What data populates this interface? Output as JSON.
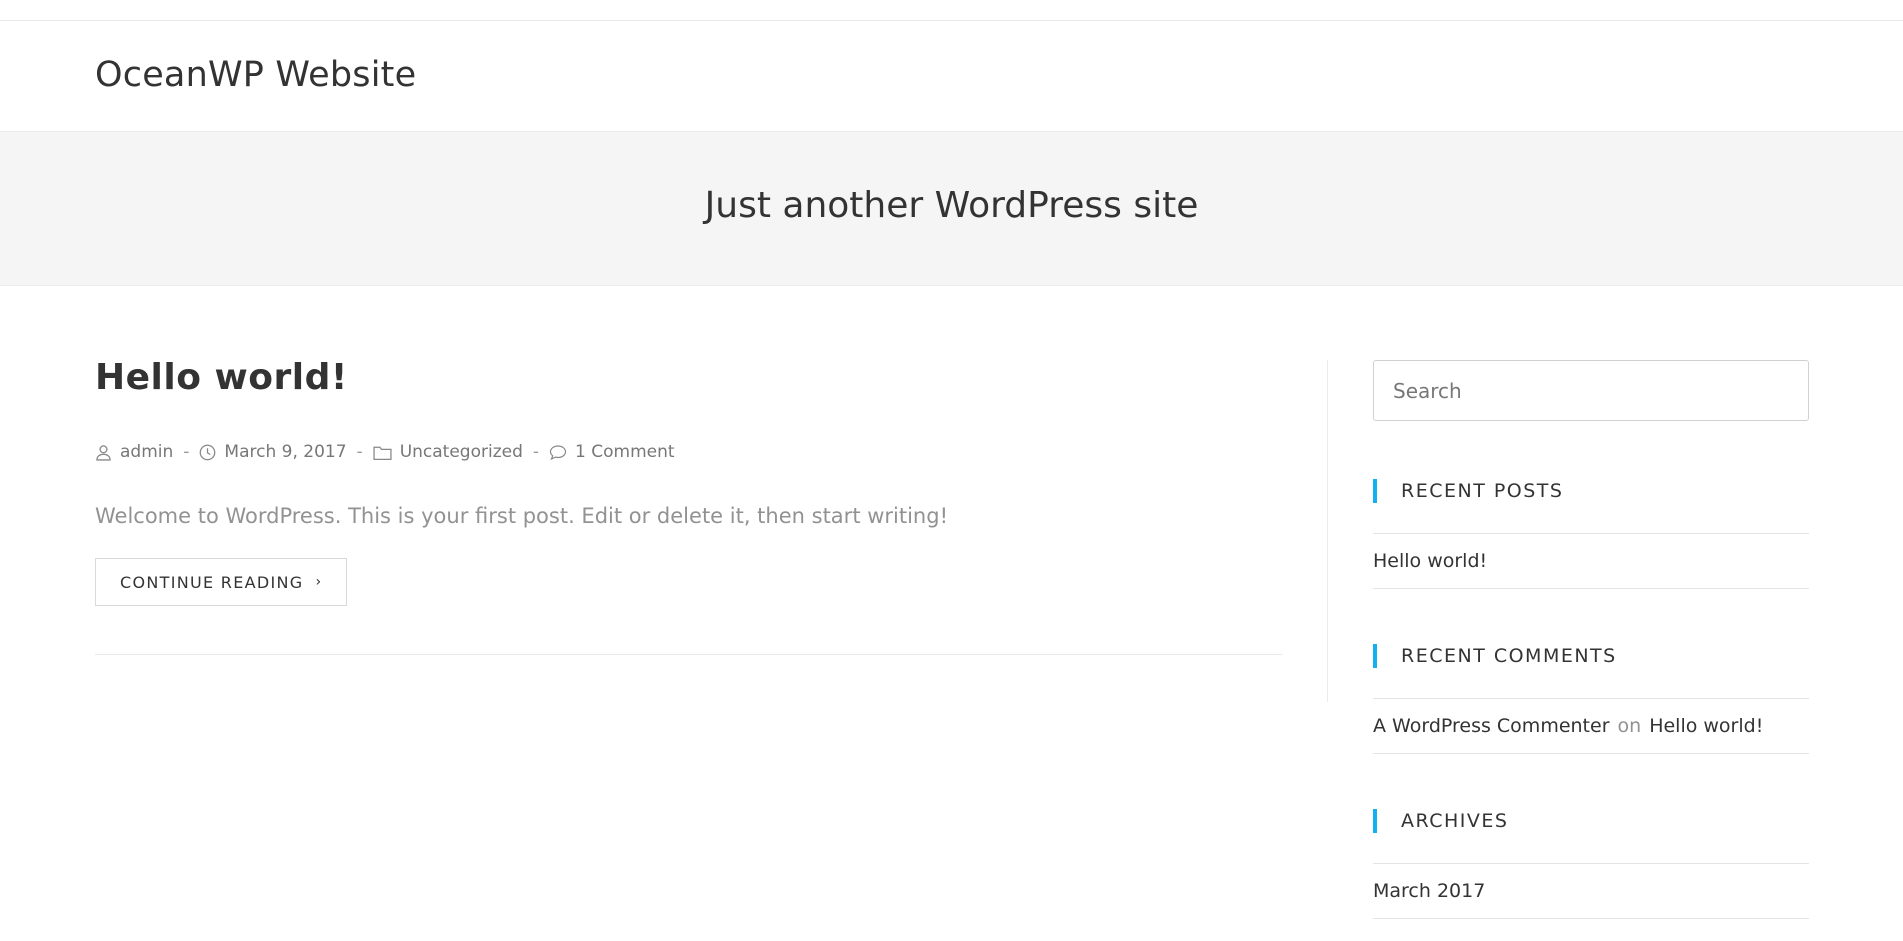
{
  "site": {
    "title": "OceanWP Website",
    "tagline": "Just another WordPress site"
  },
  "post": {
    "title": "Hello world!",
    "author": "admin",
    "date": "March 9, 2017",
    "category": "Uncategorized",
    "comments": "1 Comment",
    "separator": "-",
    "excerpt": "Welcome to WordPress. This is your first post. Edit or delete it, then start writing!",
    "continue_label": "CONTINUE READING",
    "continue_icon": "chevron-right-icon"
  },
  "sidebar": {
    "search": {
      "placeholder": "Search",
      "value": ""
    },
    "recent_posts": {
      "title": "RECENT POSTS",
      "items": [
        "Hello world!"
      ]
    },
    "recent_comments": {
      "title": "RECENT COMMENTS",
      "author": "A WordPress Commenter",
      "on": "on",
      "post": "Hello world!"
    },
    "archives": {
      "title": "ARCHIVES",
      "items": [
        "March 2017"
      ]
    }
  },
  "colors": {
    "accent": "#13aff0",
    "text": "#333333",
    "muted": "#929292",
    "header_bg": "#f5f5f5"
  }
}
